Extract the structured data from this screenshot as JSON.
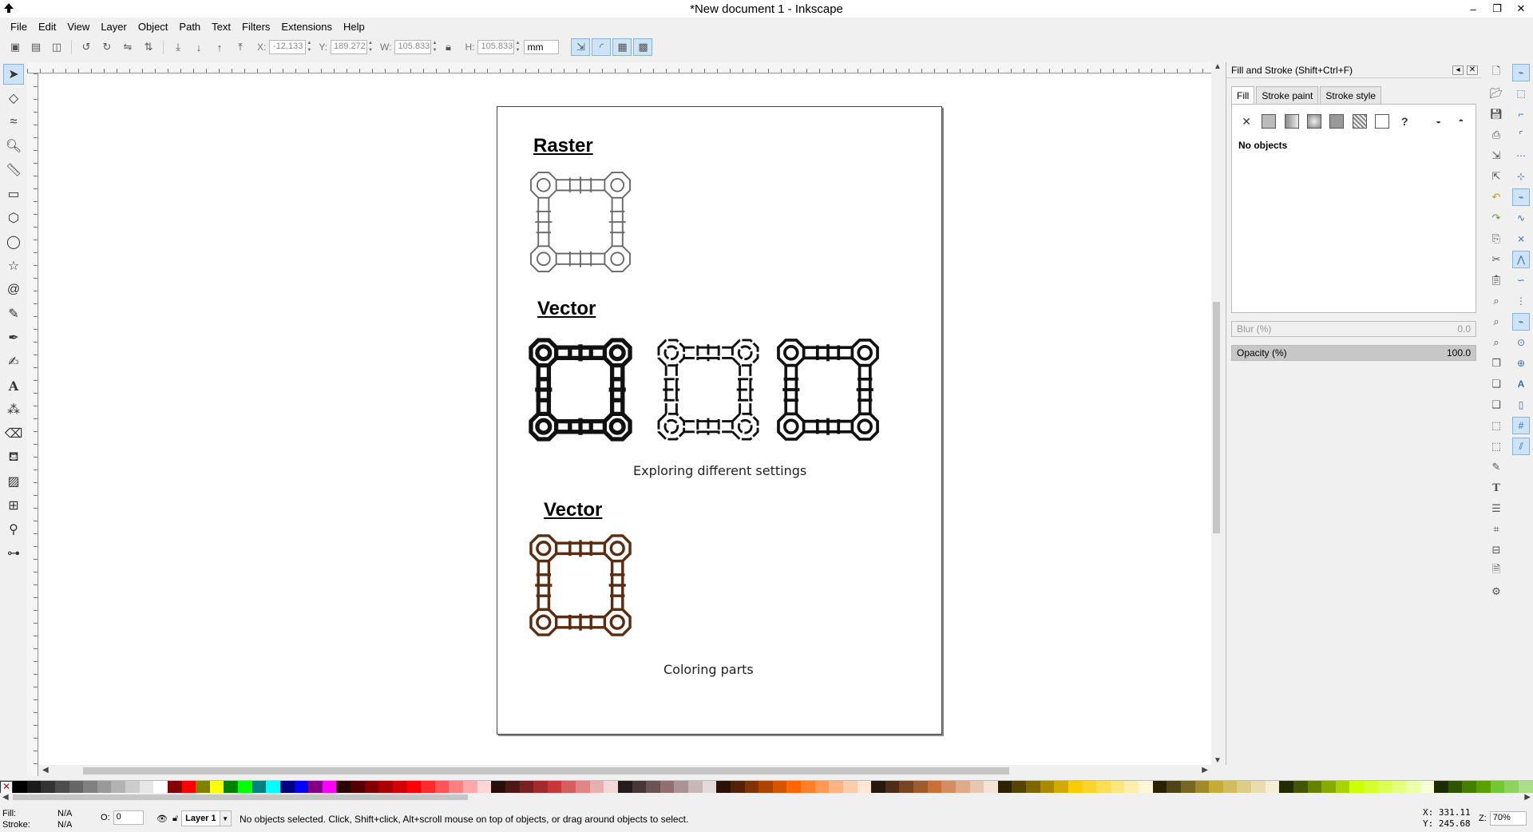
{
  "window": {
    "title": "*New document 1 - Inkscape",
    "controls": [
      "–",
      "❐",
      "✕"
    ]
  },
  "menu": [
    "File",
    "Edit",
    "View",
    "Layer",
    "Object",
    "Path",
    "Text",
    "Filters",
    "Extensions",
    "Help"
  ],
  "toolbar": {
    "x_label": "X:",
    "x_value": "-12.133",
    "y_label": "Y:",
    "y_value": "189.272",
    "w_label": "W:",
    "w_value": "105.833",
    "h_label": "H:",
    "h_value": "105.833",
    "unit": "mm"
  },
  "document": {
    "raster_title": "Raster",
    "vector_title_1": "Vector",
    "caption_1": "Exploring different settings",
    "vector_title_2": "Vector",
    "caption_2": "Coloring parts",
    "art_colors": {
      "raster": "#666666",
      "vector_black": "#111111",
      "vector_brown": "#5a2d12"
    }
  },
  "panel": {
    "title": "Fill and Stroke (Shift+Ctrl+F)",
    "tabs": [
      "Fill",
      "Stroke paint",
      "Stroke style"
    ],
    "no_objects": "No objects",
    "blur_label": "Blur (%)",
    "blur_value": "0.0",
    "opacity_label": "Opacity (%)",
    "opacity_value": "100.0"
  },
  "status": {
    "fill_label": "Fill:",
    "fill_value": "N/A",
    "stroke_label": "Stroke:",
    "stroke_value": "N/A",
    "o_label": "O:",
    "o_value": "0",
    "layer": "Layer 1",
    "message": "No objects selected. Click, Shift+click, Alt+scroll mouse on top of objects, or drag around objects to select.",
    "x_coord": "X:  331.11",
    "y_coord": "Y:  245.68",
    "zoom_label": "Z:",
    "zoom_value": "70%"
  },
  "palette_colors": [
    "#000000",
    "#1a1a1a",
    "#333333",
    "#4d4d4d",
    "#666666",
    "#808080",
    "#999999",
    "#b3b3b3",
    "#cccccc",
    "#e6e6e6",
    "#ffffff",
    "#800000",
    "#ff0000",
    "#808000",
    "#ffff00",
    "#008000",
    "#00ff00",
    "#008080",
    "#00ffff",
    "#000080",
    "#0000ff",
    "#800080",
    "#ff00ff",
    "#2b0000",
    "#550000",
    "#800000",
    "#aa0000",
    "#d40000",
    "#ff0000",
    "#ff2a2a",
    "#ff5555",
    "#ff8080",
    "#ffaaaa",
    "#ffd5d5",
    "#280b0b",
    "#501616",
    "#782121",
    "#a02c2c",
    "#c83737",
    "#d35f5f",
    "#de8787",
    "#e9afaf",
    "#f4d7d7",
    "#241c1c",
    "#483737",
    "#6c5353",
    "#916f6f",
    "#ac9393",
    "#c8b7b7",
    "#e3dbdb",
    "#2b1100",
    "#552200",
    "#803300",
    "#aa4400",
    "#d45500",
    "#ff6600",
    "#ff7f2a",
    "#ff9955",
    "#ffb380",
    "#ffccaa",
    "#ffe6d5",
    "#28170b",
    "#502d16",
    "#784421",
    "#a05a2c",
    "#c87137",
    "#d38d5f",
    "#deaa87",
    "#e9c6af",
    "#f4e3d7",
    "#2b2200",
    "#554400",
    "#806600",
    "#aa8800",
    "#d4aa00",
    "#ffcc00",
    "#ffd42a",
    "#ffdd55",
    "#ffe680",
    "#ffeeaa",
    "#fff6d5",
    "#282200",
    "#504416",
    "#786721",
    "#a0892c",
    "#c8ab37",
    "#d3bc5f",
    "#decd87",
    "#e9ddaf",
    "#f4eed7",
    "#222b00",
    "#445500",
    "#668000",
    "#88aa00",
    "#aad400",
    "#ccff00",
    "#d4ff2a",
    "#ddff55",
    "#e5ff80",
    "#eeffaa",
    "#f6ffd5",
    "#1c2b00",
    "#2d5500",
    "#448000",
    "#5aa000",
    "#71c837",
    "#8dd35f",
    "#aade87"
  ]
}
